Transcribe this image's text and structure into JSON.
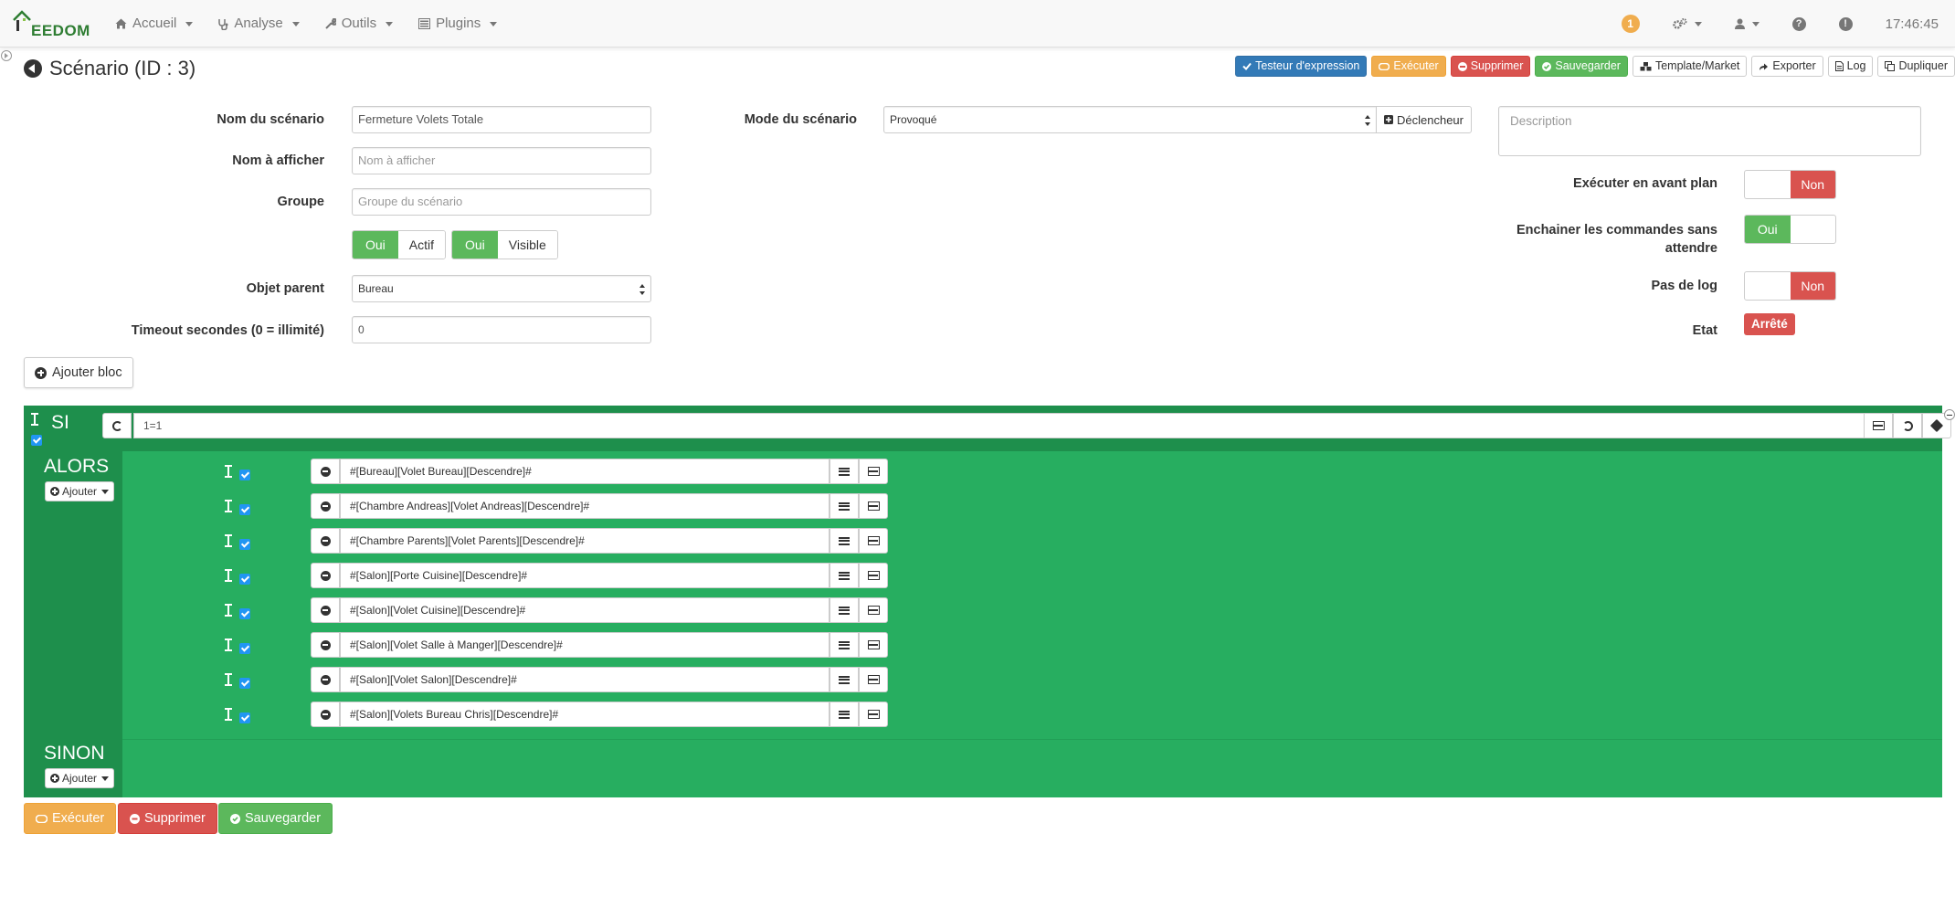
{
  "nav": {
    "brand": "EEDOM",
    "menu": [
      {
        "label": "Accueil",
        "icon": "home-icon"
      },
      {
        "label": "Analyse",
        "icon": "stethoscope-icon"
      },
      {
        "label": "Outils",
        "icon": "wrench-icon"
      },
      {
        "label": "Plugins",
        "icon": "tasks-icon"
      }
    ],
    "notification_count": "1",
    "clock": "17:46:45"
  },
  "page": {
    "title": "Scénario (ID : 3)"
  },
  "toolbar": {
    "tester": "Testeur d'expression",
    "execute": "Exécuter",
    "delete": "Supprimer",
    "save": "Sauvegarder",
    "template": "Template/Market",
    "export": "Exporter",
    "log": "Log",
    "duplicate": "Dupliquer"
  },
  "form": {
    "name_label": "Nom du scénario",
    "name_value": "Fermeture Volets Totale",
    "display_label": "Nom à afficher",
    "display_placeholder": "Nom à afficher",
    "group_label": "Groupe",
    "group_placeholder": "Groupe du scénario",
    "active_on": "Oui",
    "active_label": "Actif",
    "visible_on": "Oui",
    "visible_label": "Visible",
    "parent_label": "Objet parent",
    "parent_value": "Bureau",
    "timeout_label": "Timeout secondes (0 = illimité)",
    "timeout_value": "0",
    "mode_label": "Mode du scénario",
    "mode_value": "Provoqué",
    "trigger_button": "Déclencheur",
    "description_placeholder": "Description",
    "foreground_label": "Exécuter en avant plan",
    "foreground_value": "Non",
    "chain_label": "Enchainer les commandes sans attendre",
    "chain_value": "Oui",
    "nolog_label": "Pas de log",
    "nolog_value": "Non",
    "state_label": "Etat",
    "state_value": "Arrêté"
  },
  "add_block": "Ajouter bloc",
  "block": {
    "if_keyword": "SI",
    "condition": "1=1",
    "then_keyword": "ALORS",
    "else_keyword": "SINON",
    "add_label": "Ajouter",
    "actions": [
      "#[Bureau][Volet Bureau][Descendre]#",
      "#[Chambre Andreas][Volet Andreas][Descendre]#",
      "#[Chambre Parents][Volet Parents][Descendre]#",
      "#[Salon][Porte Cuisine][Descendre]#",
      "#[Salon][Volet Cuisine][Descendre]#",
      "#[Salon][Volet Salle à Manger][Descendre]#",
      "#[Salon][Volet Salon][Descendre]#",
      "#[Salon][Volets Bureau Chris][Descendre]#"
    ]
  },
  "footer": {
    "execute": "Exécuter",
    "delete": "Supprimer",
    "save": "Sauvegarder"
  }
}
